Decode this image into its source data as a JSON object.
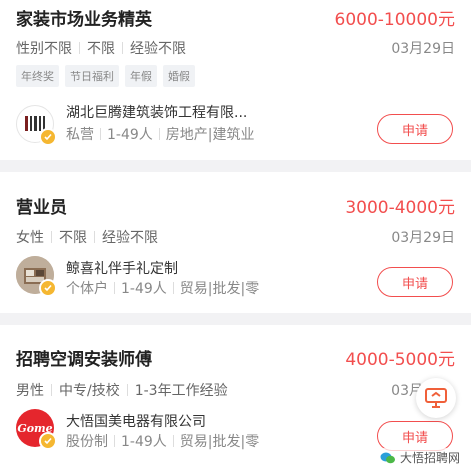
{
  "jobs": [
    {
      "title": "家装市场业务精英",
      "salary": "6000-10000元",
      "requirements": [
        "性别不限",
        "不限",
        "经验不限"
      ],
      "date": "03月29日",
      "tags": [
        "年终奖",
        "节日福利",
        "年假",
        "婚假"
      ],
      "company": "湖北巨腾建筑装饰工程有限...",
      "company_meta": [
        "私营",
        "1-49人",
        "房地产|建筑业"
      ],
      "apply_label": "申请"
    },
    {
      "title": "营业员",
      "salary": "3000-4000元",
      "requirements": [
        "女性",
        "不限",
        "经验不限"
      ],
      "date": "03月29日",
      "tags": [],
      "company": "鲸喜礼伴手礼定制",
      "company_meta": [
        "个体户",
        "1-49人",
        "贸易|批发|零"
      ],
      "apply_label": "申请"
    },
    {
      "title": "招聘空调安装师傅",
      "salary": "4000-5000元",
      "requirements": [
        "男性",
        "中专/技校",
        "1-3年工作经验"
      ],
      "date": "03月",
      "tags": [],
      "company": "大悟国美电器有限公司",
      "company_meta": [
        "股份制",
        "1-49人",
        "贸易|批发|零"
      ],
      "apply_label": "申请",
      "logo_text": "Gome"
    }
  ],
  "watermark": "大悟招聘网",
  "colors": {
    "accent": "#f24e4e",
    "verified": "#f5b731",
    "background": "#f2f2f4"
  }
}
